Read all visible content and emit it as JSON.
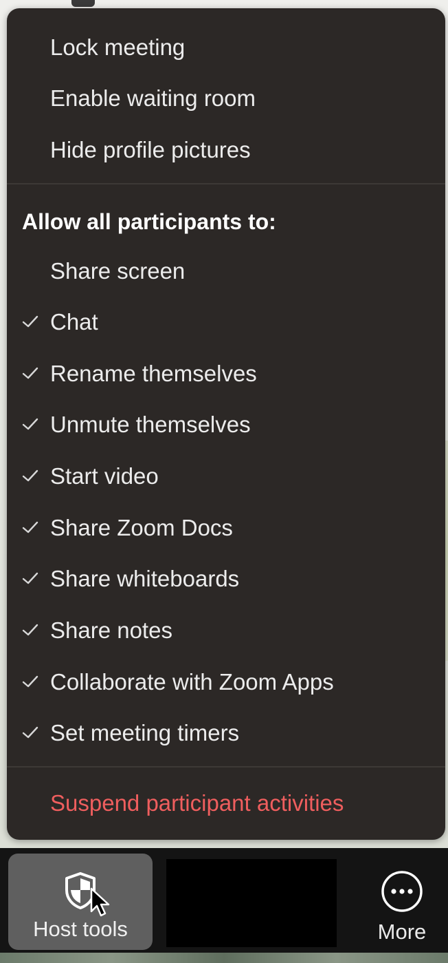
{
  "menu": {
    "items_top": [
      {
        "label": "Lock meeting",
        "checked": false
      },
      {
        "label": "Enable waiting room",
        "checked": false
      },
      {
        "label": "Hide profile pictures",
        "checked": false
      }
    ],
    "section_heading": "Allow all participants to:",
    "permissions": [
      {
        "label": "Share screen",
        "checked": false
      },
      {
        "label": "Chat",
        "checked": true
      },
      {
        "label": "Rename themselves",
        "checked": true
      },
      {
        "label": "Unmute themselves",
        "checked": true
      },
      {
        "label": "Start video",
        "checked": true
      },
      {
        "label": "Share Zoom Docs",
        "checked": true
      },
      {
        "label": "Share whiteboards",
        "checked": true
      },
      {
        "label": "Share notes",
        "checked": true
      },
      {
        "label": "Collaborate with Zoom Apps",
        "checked": true
      },
      {
        "label": "Set meeting timers",
        "checked": true
      }
    ],
    "suspend_label": "Suspend participant activities"
  },
  "toolbar": {
    "host_tools_label": "Host tools",
    "more_label": "More",
    "host_tools_icon": "shield-icon",
    "more_icon": "more-dots-icon"
  },
  "colors": {
    "menu_bg": "#2c2826",
    "text": "#ececec",
    "danger": "#ef5e5e",
    "toolbar_bg": "#141414",
    "host_button_bg": "#5f5f5f"
  }
}
